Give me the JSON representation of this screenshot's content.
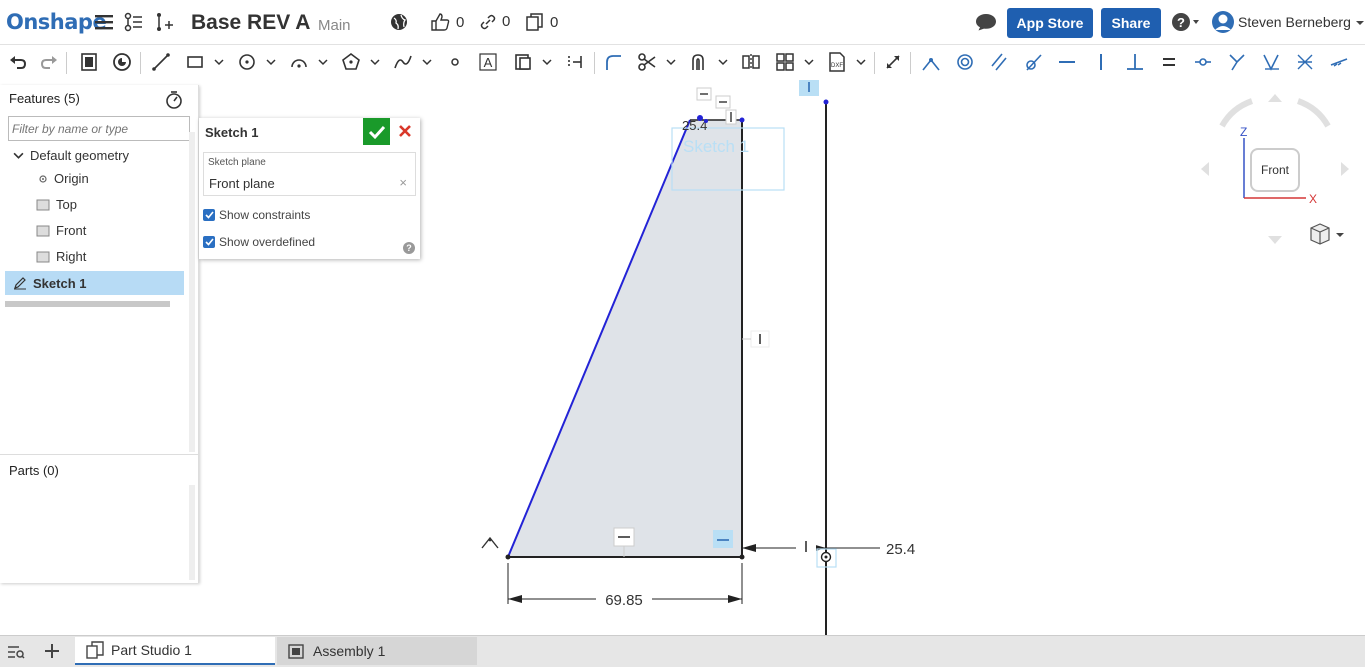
{
  "app": {
    "brand": "Onshape"
  },
  "document": {
    "title": "Base REV A",
    "branch": "Main",
    "likes": "0",
    "links": "0",
    "copies": "0"
  },
  "header": {
    "app_store_label": "App Store",
    "share_label": "Share",
    "user_name": "Steven Berneberg"
  },
  "features": {
    "title": "Features (5)",
    "filter_placeholder": "Filter by name or type",
    "default_geometry_label": "Default geometry",
    "items": [
      {
        "label": "Origin"
      },
      {
        "label": "Top"
      },
      {
        "label": "Front"
      },
      {
        "label": "Right"
      }
    ],
    "selected_item": "Sketch 1",
    "parts_title": "Parts (0)"
  },
  "sketch_panel": {
    "title": "Sketch 1",
    "plane_label": "Sketch plane",
    "plane_value": "Front plane",
    "show_constraints_label": "Show constraints",
    "show_overdefined_label": "Show overdefined",
    "show_constraints_checked": true,
    "show_overdefined_checked": true
  },
  "canvas": {
    "sketch_label": "Sketch 1",
    "dim_width": "69.85",
    "dim_offset": "25.4",
    "dim_top": "25.4",
    "view_cube_face": "Front",
    "axis_z": "Z",
    "axis_x": "X"
  },
  "tabs": [
    {
      "label": "Part Studio 1",
      "active": true
    },
    {
      "label": "Assembly 1",
      "active": false
    }
  ],
  "colors": {
    "accent": "#1f5fb0",
    "confirm": "#1a9a2a",
    "cancel": "#d9382a",
    "sketch_line": "#2323d6",
    "axis_red": "#d02020",
    "axis_blue": "#2040c0"
  }
}
